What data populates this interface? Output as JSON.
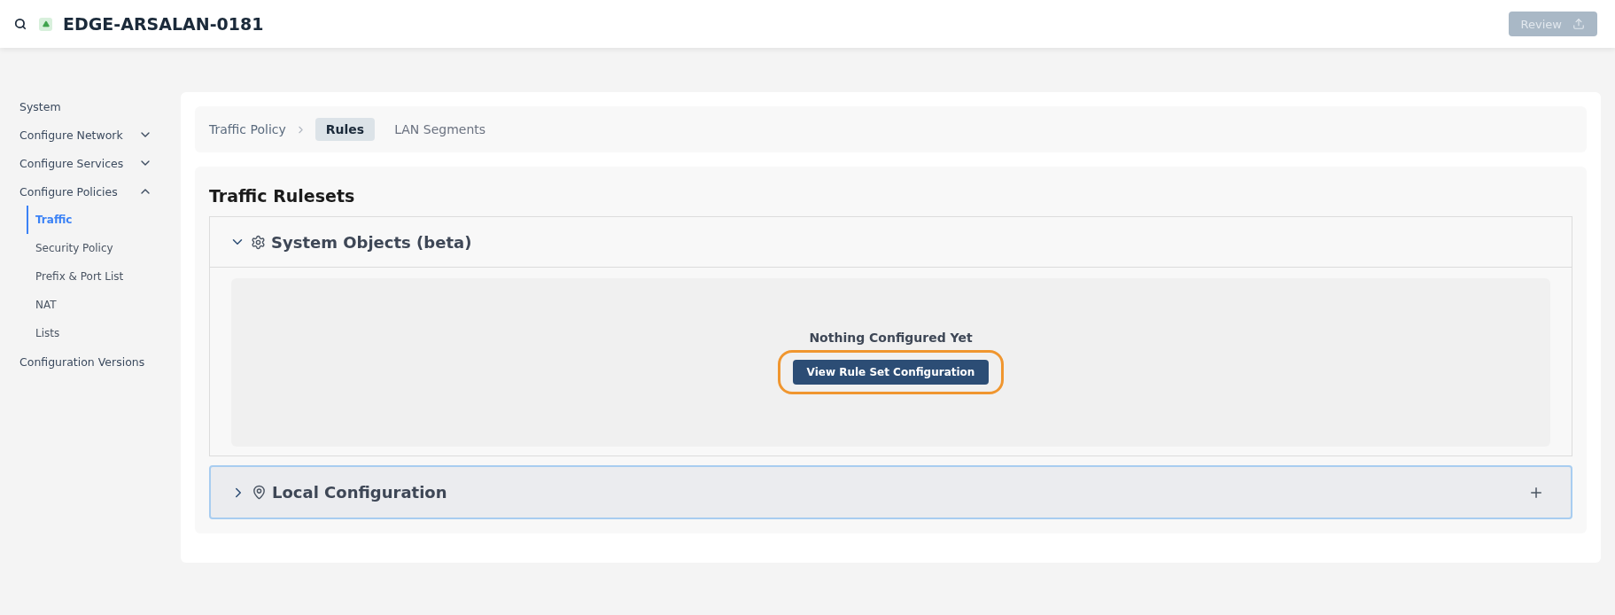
{
  "header": {
    "title": "EDGE-ARSALAN-0181",
    "review_button": {
      "label": "Review",
      "disabled": true
    }
  },
  "sidebar": {
    "items": [
      {
        "label": "System"
      },
      {
        "label": "Configure Network",
        "expanded": false
      },
      {
        "label": "Configure Services",
        "expanded": false
      },
      {
        "label": "Configure Policies",
        "expanded": true,
        "children": [
          {
            "label": "Traffic",
            "selected": true
          },
          {
            "label": "Security Policy",
            "selected": false
          },
          {
            "label": "Prefix & Port List",
            "selected": false
          },
          {
            "label": "NAT",
            "selected": false
          },
          {
            "label": "Lists",
            "selected": false
          }
        ]
      },
      {
        "label": "Configuration Versions"
      }
    ]
  },
  "breadcrumb": [
    {
      "label": "Traffic Policy",
      "kind": "link"
    },
    {
      "label": "Rules",
      "kind": "tab",
      "selected": true
    },
    {
      "label": "LAN Segments",
      "kind": "tab",
      "selected": false
    }
  ],
  "rulesets": {
    "title": "Traffic Rulesets",
    "sections": [
      {
        "title": "System Objects (beta)",
        "kind": "system",
        "expanded": true,
        "empty_message": "Nothing Configured Yet",
        "action": {
          "label": "View Rule Set Configuration",
          "highlighted": true
        }
      },
      {
        "title": "Local Configuration",
        "kind": "local",
        "expanded": false,
        "focused": true
      }
    ]
  }
}
